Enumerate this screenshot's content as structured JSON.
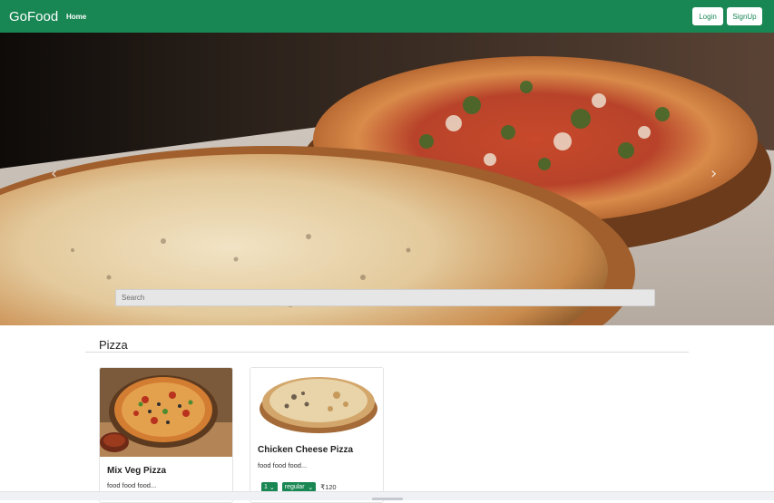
{
  "navbar": {
    "brand": "GoFood",
    "links": [
      "Home"
    ],
    "login_label": "Login",
    "signup_label": "SignUp"
  },
  "hero": {
    "search_placeholder": "Search",
    "prev_icon": "chevron-left-icon",
    "next_icon": "chevron-right-icon"
  },
  "category": {
    "title": "Pizza"
  },
  "cards": [
    {
      "title": "Mix Veg Pizza",
      "description": "food food food..."
    },
    {
      "title": "Chicken Cheese Pizza",
      "description": "food food food...",
      "quantity": "1",
      "size": "regular",
      "price": "₹120"
    }
  ],
  "colors": {
    "brand": "#198754"
  }
}
